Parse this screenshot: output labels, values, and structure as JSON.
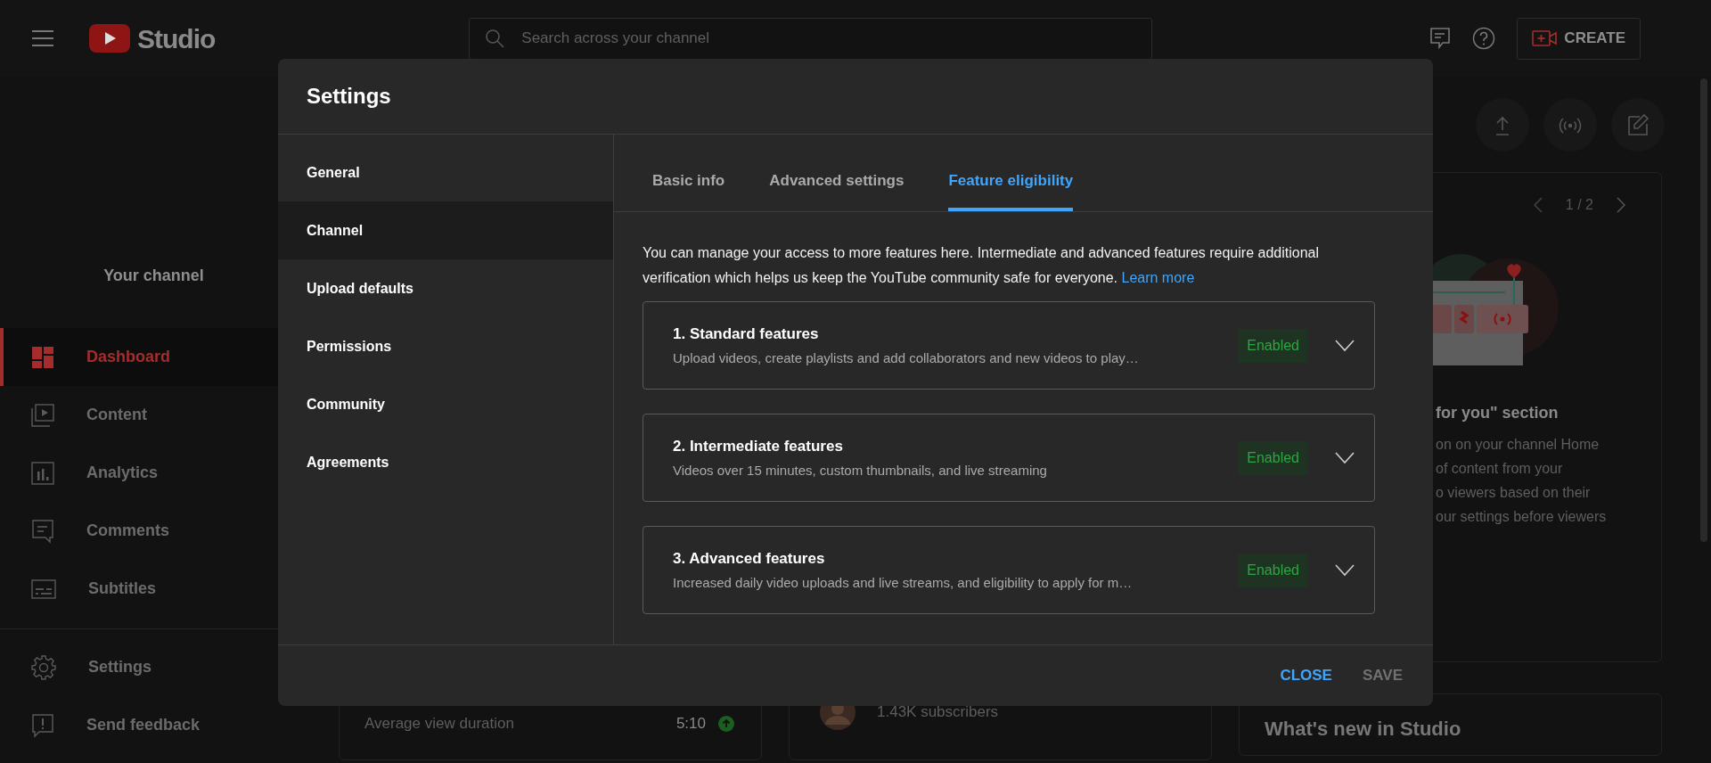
{
  "topbar": {
    "logo_text": "Studio",
    "search": {
      "placeholder": "Search across your channel"
    },
    "create_button": "CREATE"
  },
  "sidebar": {
    "channel_label": "Your channel",
    "items": [
      {
        "label": "Dashboard",
        "selected": true
      },
      {
        "label": "Content",
        "selected": false
      },
      {
        "label": "Analytics",
        "selected": false
      },
      {
        "label": "Comments",
        "selected": false
      },
      {
        "label": "Subtitles",
        "selected": false
      }
    ],
    "footer_items": [
      {
        "label": "Settings"
      },
      {
        "label": "Send feedback"
      }
    ]
  },
  "dashboard": {
    "carousel_counter": "1 / 2",
    "card_heading": "for you\" section",
    "card_lines": [
      "on on your channel Home",
      "of content from your",
      "o viewers based on their",
      "our settings before viewers"
    ],
    "stat_label": "Average view duration",
    "stat_value": "5:10",
    "subscribers": "1.43K subscribers",
    "whats_new_title": "What's new in Studio"
  },
  "dialog": {
    "title": "Settings",
    "nav": [
      {
        "label": "General",
        "selected": false
      },
      {
        "label": "Channel",
        "selected": true
      },
      {
        "label": "Upload defaults",
        "selected": false
      },
      {
        "label": "Permissions",
        "selected": false
      },
      {
        "label": "Community",
        "selected": false
      },
      {
        "label": "Agreements",
        "selected": false
      }
    ],
    "tabs": [
      {
        "label": "Basic info",
        "selected": false
      },
      {
        "label": "Advanced settings",
        "selected": false
      },
      {
        "label": "Feature eligibility",
        "selected": true
      }
    ],
    "intro": "You can manage your access to more features here. Intermediate and advanced features require additional verification which helps us keep the YouTube community safe for everyone.",
    "intro_link": "Learn more",
    "features": [
      {
        "title": "1. Standard features",
        "description": "Upload videos, create playlists and add collaborators and new videos to play…",
        "status": "Enabled",
        "expanded": false
      },
      {
        "title": "2. Intermediate features",
        "description": "Videos over 15 minutes, custom thumbnails, and live streaming",
        "status": "Enabled",
        "expanded": false
      },
      {
        "title": "3. Advanced features",
        "description": "Increased daily video uploads and live streams, and eligibility to apply for m…",
        "status": "Enabled",
        "expanded": false
      }
    ],
    "buttons": [
      {
        "label": "CLOSE",
        "disabled": false
      },
      {
        "label": "SAVE",
        "disabled": true
      }
    ]
  }
}
